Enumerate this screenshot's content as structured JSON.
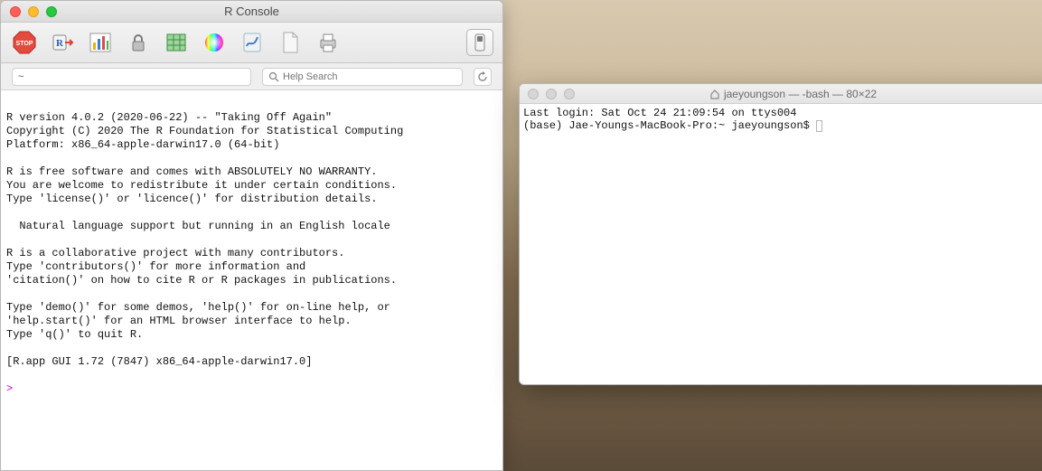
{
  "r": {
    "title": "R Console",
    "path": "~",
    "search_placeholder": "Help Search",
    "lines": [
      "",
      "R version 4.0.2 (2020-06-22) -- \"Taking Off Again\"",
      "Copyright (C) 2020 The R Foundation for Statistical Computing",
      "Platform: x86_64-apple-darwin17.0 (64-bit)",
      "",
      "R is free software and comes with ABSOLUTELY NO WARRANTY.",
      "You are welcome to redistribute it under certain conditions.",
      "Type 'license()' or 'licence()' for distribution details.",
      "",
      "  Natural language support but running in an English locale",
      "",
      "R is a collaborative project with many contributors.",
      "Type 'contributors()' for more information and",
      "'citation()' on how to cite R or R packages in publications.",
      "",
      "Type 'demo()' for some demos, 'help()' for on-line help, or",
      "'help.start()' for an HTML browser interface to help.",
      "Type 'q()' to quit R.",
      "",
      "[R.app GUI 1.72 (7847) x86_64-apple-darwin17.0]",
      ""
    ],
    "prompt": "> "
  },
  "terminal": {
    "title": "jaeyoungson — -bash — 80×22",
    "lines": [
      "Last login: Sat Oct 24 21:09:54 on ttys004",
      "(base) Jae-Youngs-MacBook-Pro:~ jaeyoungson$ "
    ]
  },
  "icons": {
    "stop": "STOP",
    "r_arrow": "R",
    "chart": "chart",
    "lock": "lock",
    "table": "table",
    "color": "color",
    "quartz": "quartz",
    "new": "new",
    "print": "print",
    "pref": "pref",
    "home": "home",
    "search": "search",
    "refresh": "refresh"
  }
}
